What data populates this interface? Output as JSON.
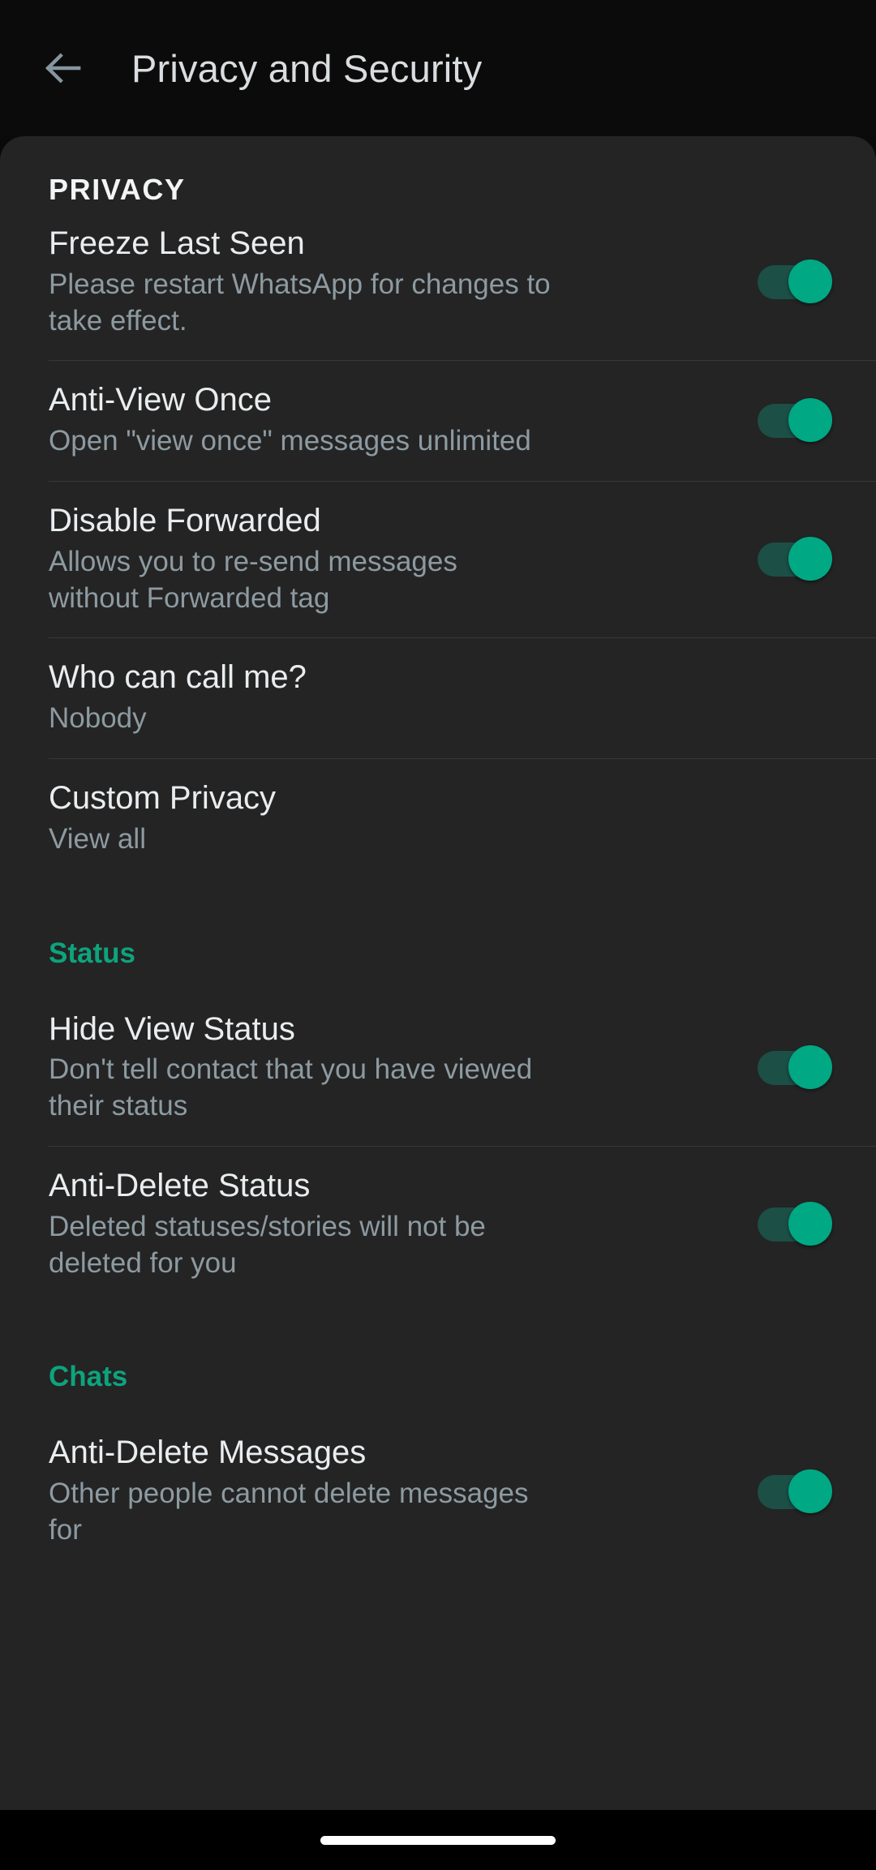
{
  "header": {
    "back_icon": "arrow-left-icon",
    "title": "Privacy and Security"
  },
  "colors": {
    "accent_green": "#0da37d",
    "toggle_thumb": "#00a884",
    "toggle_track": "#1c4f46",
    "card_bg": "#242424",
    "page_bg": "#0b0b0b",
    "title_text": "#eaedef",
    "subtitle_text": "#8d9aa1",
    "back_icon": "#8696a0"
  },
  "sections": [
    {
      "heading": "PRIVACY",
      "heading_style": "caps",
      "items": [
        {
          "title": "Freeze Last Seen",
          "subtitle": "Please restart WhatsApp for changes to take effect.",
          "control": "toggle",
          "toggle_state": "on"
        },
        {
          "title": "Anti-View Once",
          "subtitle": "Open \"view once\" messages unlimited",
          "control": "toggle",
          "toggle_state": "on"
        },
        {
          "title": "Disable Forwarded",
          "subtitle": "Allows you to re-send messages without Forwarded tag",
          "control": "toggle",
          "toggle_state": "on"
        },
        {
          "title": "Who can call me?",
          "subtitle": "Nobody",
          "control": "none",
          "toggle_state": ""
        },
        {
          "title": "Custom Privacy",
          "subtitle": "View all",
          "control": "none",
          "toggle_state": ""
        }
      ]
    },
    {
      "heading": "Status",
      "heading_style": "accent",
      "items": [
        {
          "title": "Hide View Status",
          "subtitle": "Don't tell contact that you have viewed their status",
          "control": "toggle",
          "toggle_state": "on"
        },
        {
          "title": "Anti-Delete Status",
          "subtitle": "Deleted statuses/stories will not be deleted for you",
          "control": "toggle",
          "toggle_state": "on"
        }
      ]
    },
    {
      "heading": "Chats",
      "heading_style": "accent",
      "items": [
        {
          "title": "Anti-Delete Messages",
          "subtitle": "Other people cannot delete messages for",
          "control": "toggle",
          "toggle_state": "on"
        }
      ]
    }
  ],
  "navbar": {
    "gesture_pill": "home-gesture-pill"
  }
}
